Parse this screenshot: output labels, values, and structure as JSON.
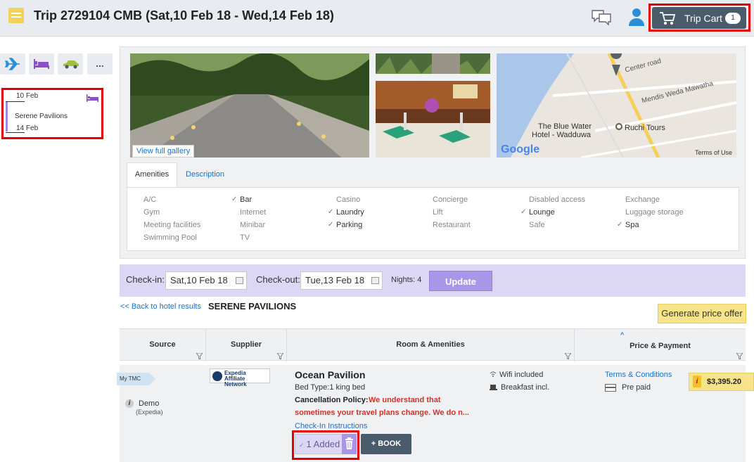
{
  "header": {
    "title": "Trip 2729104 CMB (Sat,10 Feb 18 - Wed,14 Feb 18)",
    "cart_label": "Trip Cart",
    "cart_count": "1"
  },
  "nav": {
    "more_label": "..."
  },
  "mini_itinerary": {
    "start_date": "10 Feb",
    "hotel": "Serene Pavilions",
    "end_date": "14 Feb"
  },
  "gallery": {
    "view_full_label": "View full gallery"
  },
  "map": {
    "labels": [
      "Center road",
      "Mendis Weda Mawatha",
      "The Blue Water",
      "Hotel - Wadduwa",
      "Ruchi Tours",
      "Google",
      "Terms of Use"
    ]
  },
  "tabs": {
    "amenities": "Amenities",
    "description": "Description"
  },
  "amenities": [
    {
      "label": "A/C",
      "on": false
    },
    {
      "label": "Bar",
      "on": true
    },
    {
      "label": "Casino",
      "on": false
    },
    {
      "label": "Concierge",
      "on": false
    },
    {
      "label": "Disabled access",
      "on": false
    },
    {
      "label": "Exchange",
      "on": false
    },
    {
      "label": "Gym",
      "on": false
    },
    {
      "label": "Internet",
      "on": false
    },
    {
      "label": "Laundry",
      "on": true
    },
    {
      "label": "Lift",
      "on": false
    },
    {
      "label": "Lounge",
      "on": true
    },
    {
      "label": "Luggage storage",
      "on": false
    },
    {
      "label": "Meeting facilities",
      "on": false
    },
    {
      "label": "Minibar",
      "on": false
    },
    {
      "label": "Parking",
      "on": true
    },
    {
      "label": "Restaurant",
      "on": false
    },
    {
      "label": "Safe",
      "on": false
    },
    {
      "label": "Spa",
      "on": true
    },
    {
      "label": "Swimming Pool",
      "on": false
    },
    {
      "label": "TV",
      "on": false
    }
  ],
  "search": {
    "checkin_label": "Check-in:",
    "checkin_value": "Sat,10 Feb 18",
    "checkout_label": "Check-out:",
    "checkout_value": "Tue,13 Feb 18",
    "nights": "Nights: 4",
    "update_label": "Update"
  },
  "results": {
    "back_link": "<< Back to hotel results",
    "hotel_name": "SERENE PAVILIONS",
    "price_offer_label": "Generate price offer"
  },
  "table": {
    "headers": [
      "Source",
      "Supplier",
      "Room & Amenities",
      "Price & Payment"
    ]
  },
  "row": {
    "tmc_tag": "My TMC",
    "source_name": "Demo",
    "source_sub": "(Expedia)",
    "supplier_logo_text": "Expedia Affiliate Network",
    "room_name": "Ocean Pavilion",
    "bed_type": "Bed Type:1 king bed",
    "cancel_label": "Cancellation Policy:",
    "cancel_text_1": "We understand that",
    "cancel_text_2": "sometimes your travel plans change. We do n...",
    "checkin_instructions": "Check-In Instructions",
    "added_label": "1 Added",
    "book_label": "+ BOOK",
    "wifi": "Wifi included",
    "breakfast": "Breakfast incl.",
    "terms": "Terms & Conditions",
    "payment": "Pre paid",
    "price": "$3,395.20"
  },
  "colors": {
    "accent_purple": "#a996e8",
    "dark_slate": "#4a5b6c",
    "highlight_red": "#e00000",
    "price_yellow": "#f7e38a",
    "link_blue": "#1a73c8"
  }
}
